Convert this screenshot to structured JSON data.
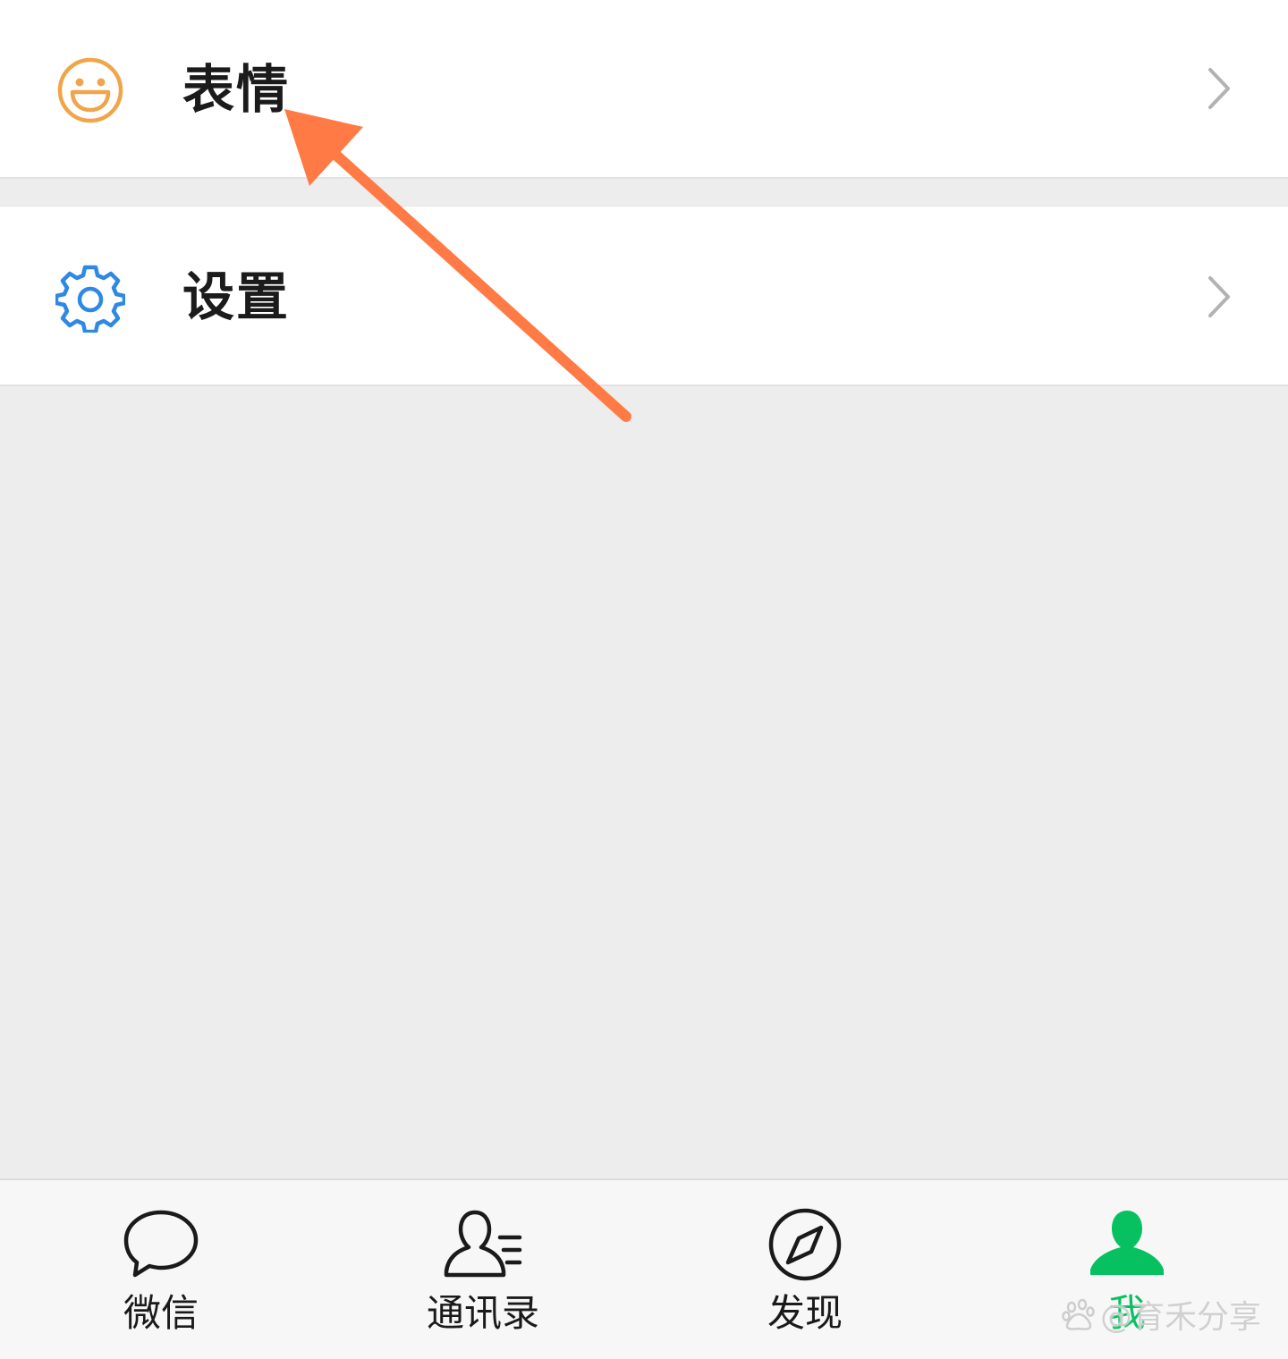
{
  "menu": {
    "emoji": {
      "label": "表情",
      "icon": "smiley-icon"
    },
    "settings": {
      "label": "设置",
      "icon": "gear-icon"
    }
  },
  "tabbar": {
    "tabs": [
      {
        "label": "微信",
        "icon": "chat-bubble-icon",
        "active": false
      },
      {
        "label": "通讯录",
        "icon": "contacts-icon",
        "active": false
      },
      {
        "label": "发现",
        "icon": "compass-icon",
        "active": false
      },
      {
        "label": "我",
        "icon": "person-icon",
        "active": true
      }
    ]
  },
  "watermark": {
    "text": "@育禾分享",
    "icon": "baidu-paw-icon"
  },
  "colors": {
    "emoji_icon": "#f0a54a",
    "settings_icon": "#2f88e3",
    "active_tab": "#07c160",
    "annotation_arrow": "#ff7a45",
    "background": "#ededed"
  }
}
